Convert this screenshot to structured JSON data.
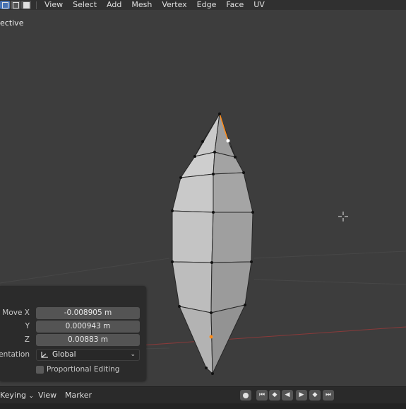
{
  "header": {
    "menu": [
      "View",
      "Select",
      "Add",
      "Mesh",
      "Vertex",
      "Edge",
      "Face",
      "UV"
    ]
  },
  "viewport": {
    "view_label": "ective"
  },
  "operator_panel": {
    "move_x_label": "Move X",
    "move_x": "-0.008905 m",
    "y_label": "Y",
    "y": "0.000943 m",
    "z_label": "Z",
    "z": "0.00883 m",
    "orientation_label": "ientation",
    "orientation": "Global",
    "proportional_label": "Proportional Editing"
  },
  "timeline": {
    "keying": "Keying",
    "view": "View",
    "marker": "Marker"
  },
  "colors": {
    "background": "#3d3d3d",
    "accent": "#4772b3",
    "selected_vertex": "#ff8c1a"
  }
}
